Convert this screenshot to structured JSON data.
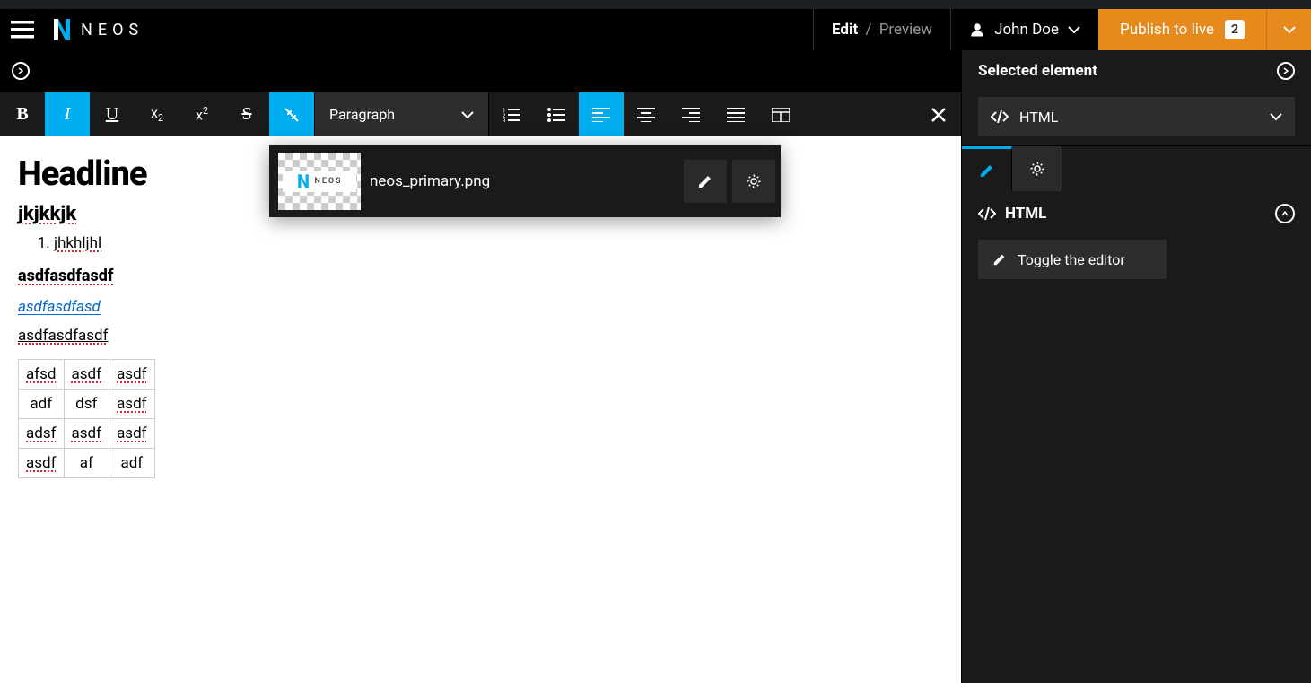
{
  "brand": {
    "name": "NEOS"
  },
  "header": {
    "edit_label": "Edit",
    "preview_label": "Preview",
    "user_name": "John Doe",
    "publish_label": "Publish to live",
    "publish_count": "2"
  },
  "inspector": {
    "header_label": "Selected element",
    "element_type": "HTML",
    "group_label": "HTML",
    "toggle_editor_label": "Toggle the editor"
  },
  "toolbar": {
    "format_dropdown": "Paragraph"
  },
  "asset": {
    "filename": "neos_primary.png",
    "thumb_text": "NEOS"
  },
  "content": {
    "headline": "Headline",
    "subhead": "jkjkkjk",
    "list_item_1": "jhkhljhl",
    "bold_line": "asdfasdfasdf",
    "italic_link": "asdfasdfasd",
    "under_line": "asdfasdfasdf",
    "table": [
      [
        "afsd",
        "asdf",
        "asdf"
      ],
      [
        "adf",
        "dsf",
        "asdf"
      ],
      [
        "adsf",
        "asdf",
        "asdf"
      ],
      [
        "asdf",
        "af",
        "adf"
      ]
    ]
  }
}
